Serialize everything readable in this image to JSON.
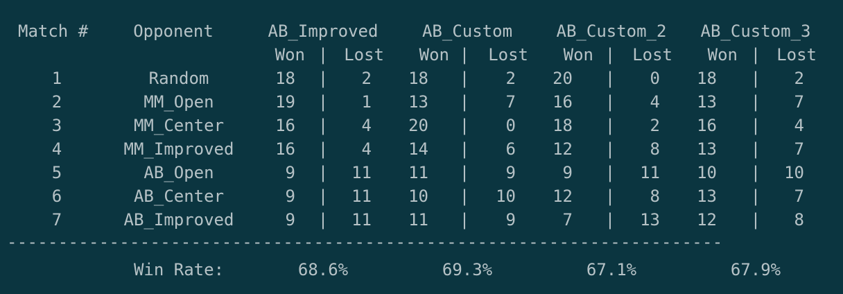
{
  "header": {
    "match_label": "Match #",
    "opponent_label": "Opponent",
    "agents": [
      "AB_Improved",
      "AB_Custom",
      "AB_Custom_2",
      "AB_Custom_3"
    ],
    "won_label": "Won",
    "pipe": "|",
    "lost_label": "Lost"
  },
  "rows": [
    {
      "match": "1",
      "opponent": "Random",
      "results": [
        [
          "18",
          "2"
        ],
        [
          "18",
          "2"
        ],
        [
          "20",
          "0"
        ],
        [
          "18",
          "2"
        ]
      ]
    },
    {
      "match": "2",
      "opponent": "MM_Open",
      "results": [
        [
          "19",
          "1"
        ],
        [
          "13",
          "7"
        ],
        [
          "16",
          "4"
        ],
        [
          "13",
          "7"
        ]
      ]
    },
    {
      "match": "3",
      "opponent": "MM_Center",
      "results": [
        [
          "16",
          "4"
        ],
        [
          "20",
          "0"
        ],
        [
          "18",
          "2"
        ],
        [
          "16",
          "4"
        ]
      ]
    },
    {
      "match": "4",
      "opponent": "MM_Improved",
      "results": [
        [
          "16",
          "4"
        ],
        [
          "14",
          "6"
        ],
        [
          "12",
          "8"
        ],
        [
          "13",
          "7"
        ]
      ]
    },
    {
      "match": "5",
      "opponent": "AB_Open",
      "results": [
        [
          "9",
          "11"
        ],
        [
          "11",
          "9"
        ],
        [
          "9",
          "11"
        ],
        [
          "10",
          "10"
        ]
      ]
    },
    {
      "match": "6",
      "opponent": "AB_Center",
      "results": [
        [
          "9",
          "11"
        ],
        [
          "10",
          "10"
        ],
        [
          "12",
          "8"
        ],
        [
          "13",
          "7"
        ]
      ]
    },
    {
      "match": "7",
      "opponent": "AB_Improved",
      "results": [
        [
          "9",
          "11"
        ],
        [
          "11",
          "9"
        ],
        [
          "7",
          "13"
        ],
        [
          "12",
          "8"
        ]
      ]
    }
  ],
  "separator": "----------------------------------------------------------------------",
  "footer": {
    "win_rate_label": "Win Rate:",
    "win_rates": [
      "68.6%",
      "69.3%",
      "67.1%",
      "67.9%"
    ]
  },
  "colors": {
    "background": "#0b3540",
    "text": "#b6c2c6"
  }
}
